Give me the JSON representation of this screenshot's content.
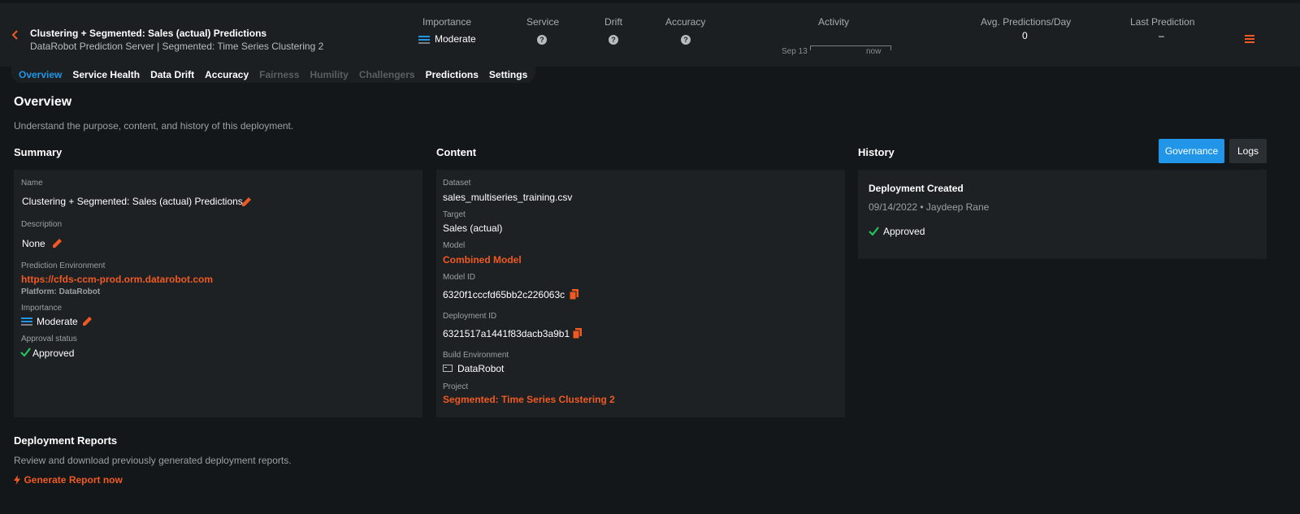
{
  "header": {
    "title": "Clustering + Segmented: Sales (actual) Predictions",
    "subtitle": "DataRobot Prediction Server | Segmented: Time Series Clustering 2",
    "metrics": {
      "importance_label": "Importance",
      "importance_value": "Moderate",
      "service_label": "Service",
      "drift_label": "Drift",
      "accuracy_label": "Accuracy",
      "activity_label": "Activity",
      "activity_start": "Sep 13",
      "activity_end": "now",
      "avg_pred_label": "Avg. Predictions/Day",
      "avg_pred_value": "0",
      "last_pred_label": "Last Prediction",
      "last_pred_value": "–"
    },
    "help_glyph": "?"
  },
  "tabs": [
    {
      "label": "Overview",
      "state": "active"
    },
    {
      "label": "Service Health",
      "state": "normal"
    },
    {
      "label": "Data Drift",
      "state": "normal"
    },
    {
      "label": "Accuracy",
      "state": "normal"
    },
    {
      "label": "Fairness",
      "state": "disabled"
    },
    {
      "label": "Humility",
      "state": "disabled"
    },
    {
      "label": "Challengers",
      "state": "disabled"
    },
    {
      "label": "Predictions",
      "state": "normal"
    },
    {
      "label": "Settings",
      "state": "normal"
    }
  ],
  "page": {
    "title": "Overview",
    "description": "Understand the purpose, content, and history of this deployment."
  },
  "summary": {
    "heading": "Summary",
    "name_label": "Name",
    "name_value": "Clustering + Segmented: Sales (actual) Predictions",
    "description_label": "Description",
    "description_value": "None",
    "env_label": "Prediction Environment",
    "env_link": "https://cfds-ccm-prod.orm.datarobot.com",
    "env_platform": "Platform: DataRobot",
    "importance_label": "Importance",
    "importance_value": "Moderate",
    "approval_label": "Approval status",
    "approval_value": "Approved"
  },
  "content": {
    "heading": "Content",
    "dataset_label": "Dataset",
    "dataset_value": "sales_multiseries_training.csv",
    "target_label": "Target",
    "target_value": "Sales (actual)",
    "model_label": "Model",
    "model_value": "Combined Model",
    "model_id_label": "Model ID",
    "model_id_value": "6320f1cccfd65bb2c226063c",
    "deployment_id_label": "Deployment ID",
    "deployment_id_value": "6321517a1441f83dacb3a9b1",
    "build_env_label": "Build Environment",
    "build_env_value": "DataRobot",
    "project_label": "Project",
    "project_value": "Segmented: Time Series Clustering 2"
  },
  "history": {
    "heading": "History",
    "governance_label": "Governance",
    "logs_label": "Logs",
    "event_title": "Deployment Created",
    "event_meta": "09/14/2022 • Jaydeep Rane",
    "event_status": "Approved"
  },
  "reports": {
    "heading": "Deployment Reports",
    "description": "Review and download previously generated deployment reports.",
    "generate_label": "Generate Report now"
  },
  "colors": {
    "accent_orange": "#f05a22",
    "accent_blue": "#2196e8",
    "success_green": "#22c55e",
    "background": "#141719",
    "panel": "#1d2124"
  },
  "icons": [
    "chevron-left-icon",
    "importance-bars-icon",
    "help-icon",
    "hamburger-menu-icon",
    "pencil-icon",
    "copy-icon",
    "check-icon",
    "server-icon",
    "lightning-icon"
  ]
}
